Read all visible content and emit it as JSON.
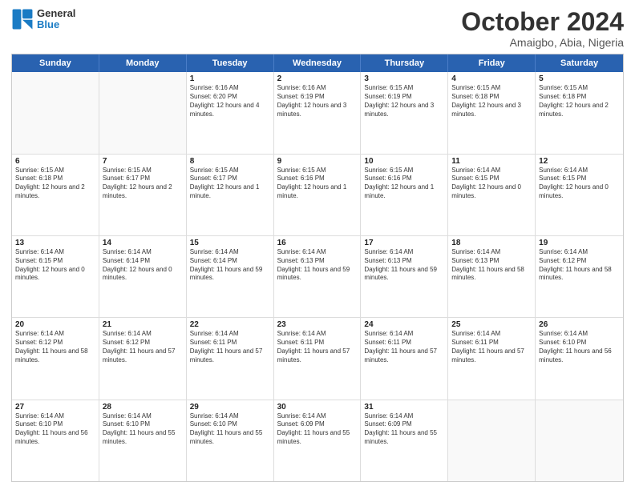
{
  "logo": {
    "line1": "General",
    "line2": "Blue"
  },
  "title": "October 2024",
  "location": "Amaigbo, Abia, Nigeria",
  "header_days": [
    "Sunday",
    "Monday",
    "Tuesday",
    "Wednesday",
    "Thursday",
    "Friday",
    "Saturday"
  ],
  "weeks": [
    [
      {
        "day": "",
        "sunrise": "",
        "sunset": "",
        "daylight": ""
      },
      {
        "day": "",
        "sunrise": "",
        "sunset": "",
        "daylight": ""
      },
      {
        "day": "1",
        "sunrise": "Sunrise: 6:16 AM",
        "sunset": "Sunset: 6:20 PM",
        "daylight": "Daylight: 12 hours and 4 minutes."
      },
      {
        "day": "2",
        "sunrise": "Sunrise: 6:16 AM",
        "sunset": "Sunset: 6:19 PM",
        "daylight": "Daylight: 12 hours and 3 minutes."
      },
      {
        "day": "3",
        "sunrise": "Sunrise: 6:15 AM",
        "sunset": "Sunset: 6:19 PM",
        "daylight": "Daylight: 12 hours and 3 minutes."
      },
      {
        "day": "4",
        "sunrise": "Sunrise: 6:15 AM",
        "sunset": "Sunset: 6:18 PM",
        "daylight": "Daylight: 12 hours and 3 minutes."
      },
      {
        "day": "5",
        "sunrise": "Sunrise: 6:15 AM",
        "sunset": "Sunset: 6:18 PM",
        "daylight": "Daylight: 12 hours and 2 minutes."
      }
    ],
    [
      {
        "day": "6",
        "sunrise": "Sunrise: 6:15 AM",
        "sunset": "Sunset: 6:18 PM",
        "daylight": "Daylight: 12 hours and 2 minutes."
      },
      {
        "day": "7",
        "sunrise": "Sunrise: 6:15 AM",
        "sunset": "Sunset: 6:17 PM",
        "daylight": "Daylight: 12 hours and 2 minutes."
      },
      {
        "day": "8",
        "sunrise": "Sunrise: 6:15 AM",
        "sunset": "Sunset: 6:17 PM",
        "daylight": "Daylight: 12 hours and 1 minute."
      },
      {
        "day": "9",
        "sunrise": "Sunrise: 6:15 AM",
        "sunset": "Sunset: 6:16 PM",
        "daylight": "Daylight: 12 hours and 1 minute."
      },
      {
        "day": "10",
        "sunrise": "Sunrise: 6:15 AM",
        "sunset": "Sunset: 6:16 PM",
        "daylight": "Daylight: 12 hours and 1 minute."
      },
      {
        "day": "11",
        "sunrise": "Sunrise: 6:14 AM",
        "sunset": "Sunset: 6:15 PM",
        "daylight": "Daylight: 12 hours and 0 minutes."
      },
      {
        "day": "12",
        "sunrise": "Sunrise: 6:14 AM",
        "sunset": "Sunset: 6:15 PM",
        "daylight": "Daylight: 12 hours and 0 minutes."
      }
    ],
    [
      {
        "day": "13",
        "sunrise": "Sunrise: 6:14 AM",
        "sunset": "Sunset: 6:15 PM",
        "daylight": "Daylight: 12 hours and 0 minutes."
      },
      {
        "day": "14",
        "sunrise": "Sunrise: 6:14 AM",
        "sunset": "Sunset: 6:14 PM",
        "daylight": "Daylight: 12 hours and 0 minutes."
      },
      {
        "day": "15",
        "sunrise": "Sunrise: 6:14 AM",
        "sunset": "Sunset: 6:14 PM",
        "daylight": "Daylight: 11 hours and 59 minutes."
      },
      {
        "day": "16",
        "sunrise": "Sunrise: 6:14 AM",
        "sunset": "Sunset: 6:13 PM",
        "daylight": "Daylight: 11 hours and 59 minutes."
      },
      {
        "day": "17",
        "sunrise": "Sunrise: 6:14 AM",
        "sunset": "Sunset: 6:13 PM",
        "daylight": "Daylight: 11 hours and 59 minutes."
      },
      {
        "day": "18",
        "sunrise": "Sunrise: 6:14 AM",
        "sunset": "Sunset: 6:13 PM",
        "daylight": "Daylight: 11 hours and 58 minutes."
      },
      {
        "day": "19",
        "sunrise": "Sunrise: 6:14 AM",
        "sunset": "Sunset: 6:12 PM",
        "daylight": "Daylight: 11 hours and 58 minutes."
      }
    ],
    [
      {
        "day": "20",
        "sunrise": "Sunrise: 6:14 AM",
        "sunset": "Sunset: 6:12 PM",
        "daylight": "Daylight: 11 hours and 58 minutes."
      },
      {
        "day": "21",
        "sunrise": "Sunrise: 6:14 AM",
        "sunset": "Sunset: 6:12 PM",
        "daylight": "Daylight: 11 hours and 57 minutes."
      },
      {
        "day": "22",
        "sunrise": "Sunrise: 6:14 AM",
        "sunset": "Sunset: 6:11 PM",
        "daylight": "Daylight: 11 hours and 57 minutes."
      },
      {
        "day": "23",
        "sunrise": "Sunrise: 6:14 AM",
        "sunset": "Sunset: 6:11 PM",
        "daylight": "Daylight: 11 hours and 57 minutes."
      },
      {
        "day": "24",
        "sunrise": "Sunrise: 6:14 AM",
        "sunset": "Sunset: 6:11 PM",
        "daylight": "Daylight: 11 hours and 57 minutes."
      },
      {
        "day": "25",
        "sunrise": "Sunrise: 6:14 AM",
        "sunset": "Sunset: 6:11 PM",
        "daylight": "Daylight: 11 hours and 57 minutes."
      },
      {
        "day": "26",
        "sunrise": "Sunrise: 6:14 AM",
        "sunset": "Sunset: 6:10 PM",
        "daylight": "Daylight: 11 hours and 56 minutes."
      }
    ],
    [
      {
        "day": "27",
        "sunrise": "Sunrise: 6:14 AM",
        "sunset": "Sunset: 6:10 PM",
        "daylight": "Daylight: 11 hours and 56 minutes."
      },
      {
        "day": "28",
        "sunrise": "Sunrise: 6:14 AM",
        "sunset": "Sunset: 6:10 PM",
        "daylight": "Daylight: 11 hours and 55 minutes."
      },
      {
        "day": "29",
        "sunrise": "Sunrise: 6:14 AM",
        "sunset": "Sunset: 6:10 PM",
        "daylight": "Daylight: 11 hours and 55 minutes."
      },
      {
        "day": "30",
        "sunrise": "Sunrise: 6:14 AM",
        "sunset": "Sunset: 6:09 PM",
        "daylight": "Daylight: 11 hours and 55 minutes."
      },
      {
        "day": "31",
        "sunrise": "Sunrise: 6:14 AM",
        "sunset": "Sunset: 6:09 PM",
        "daylight": "Daylight: 11 hours and 55 minutes."
      },
      {
        "day": "",
        "sunrise": "",
        "sunset": "",
        "daylight": ""
      },
      {
        "day": "",
        "sunrise": "",
        "sunset": "",
        "daylight": ""
      }
    ]
  ]
}
